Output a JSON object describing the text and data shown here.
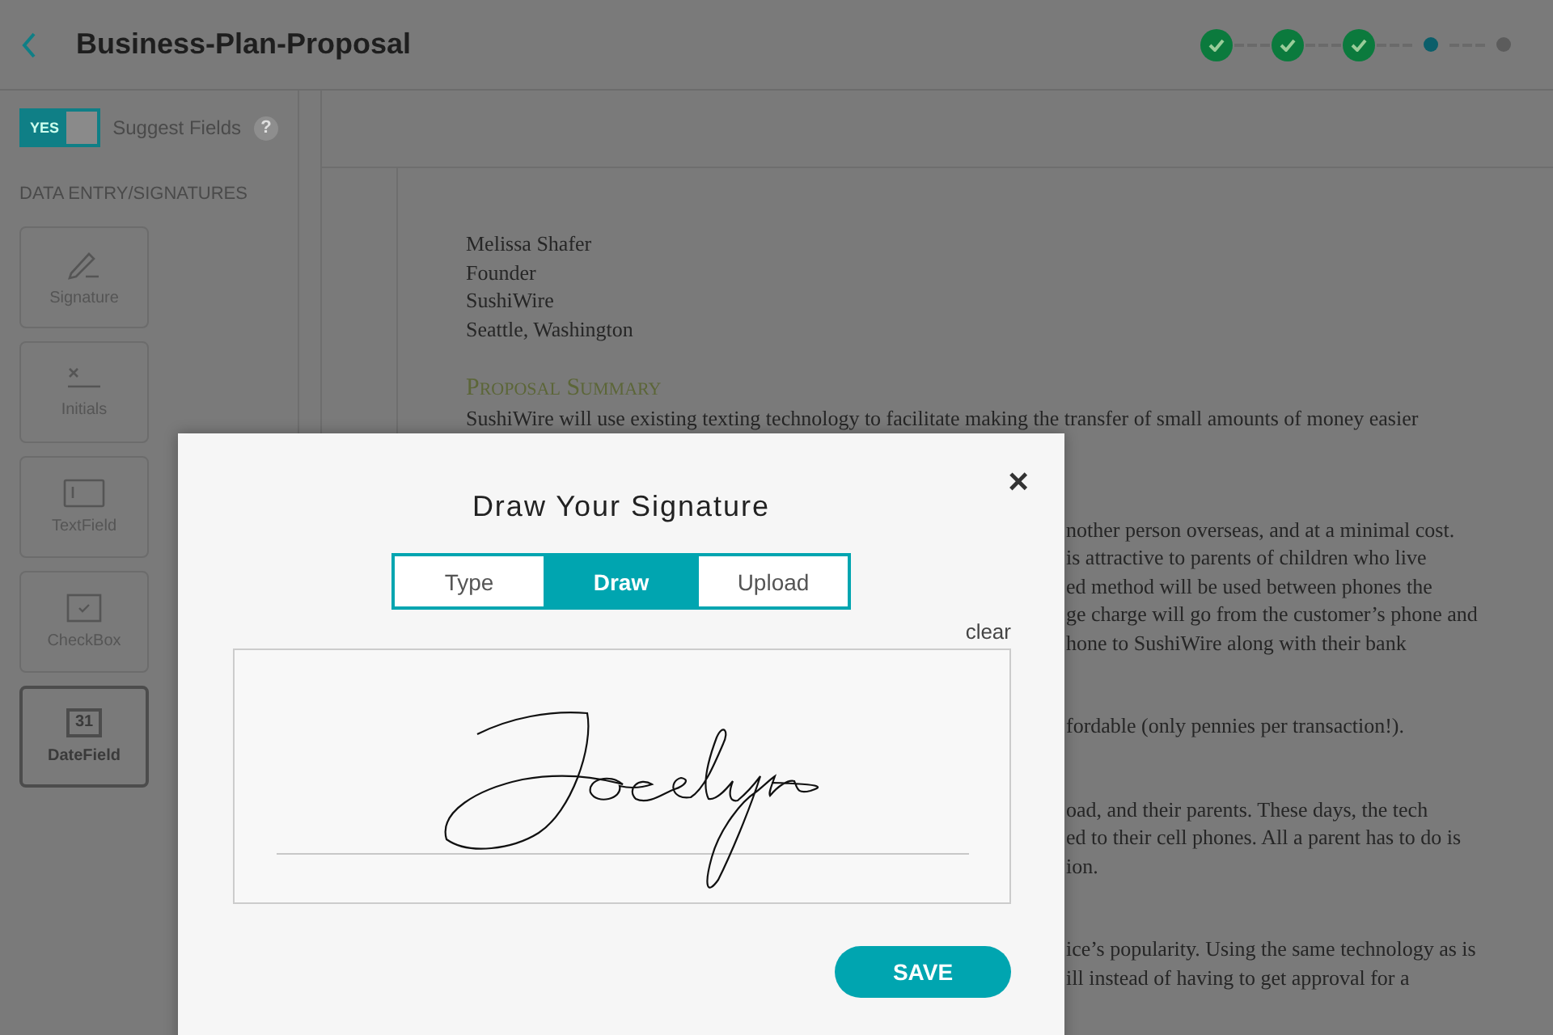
{
  "header": {
    "title": "Business-Plan-Proposal",
    "steps": [
      {
        "done": true,
        "current": false
      },
      {
        "done": true,
        "current": false
      },
      {
        "done": true,
        "current": false
      },
      {
        "done": false,
        "current": true
      },
      {
        "done": false,
        "current": false
      }
    ]
  },
  "sidebar": {
    "suggest_toggle": {
      "on": true,
      "label": "YES"
    },
    "suggest_label": "Suggest Fields",
    "help": "?",
    "section": "DATA ENTRY/SIGNATURES",
    "tools": [
      {
        "kind": "signature",
        "label": "Signature",
        "selected": false
      },
      {
        "kind": "initials",
        "label": "Initials",
        "selected": false
      },
      {
        "kind": "textfield",
        "label": "TextField",
        "selected": false
      },
      {
        "kind": "checkbox",
        "label": "CheckBox",
        "selected": false
      },
      {
        "kind": "date",
        "label": "DateField",
        "icon_text": "31",
        "selected": true
      }
    ]
  },
  "document": {
    "address": [
      "Melissa Shafer",
      "Founder",
      "SushiWire",
      "Seattle, Washington"
    ],
    "heading": "Proposal Summary",
    "summary_line": "SushiWire will use existing texting technology to facilitate making the transfer of small amounts of money easier",
    "fragments": [
      [
        "nother person overseas, and at a minimal cost.",
        "is attractive to parents of children who live",
        "ed method will be used between phones the",
        "ge charge will go from the customer’s phone and",
        "hone to SushiWire along with their bank"
      ],
      [
        "fordable (only pennies per transaction!)."
      ],
      [
        "oad, and their parents. These days, the tech",
        "ed to their cell phones. All a parent has to do is",
        "ion."
      ],
      [
        "ice’s popularity. Using the same technology as is",
        "ill instead of having to get approval for a"
      ]
    ]
  },
  "dialog": {
    "title": "Draw Your Signature",
    "close": "×",
    "tabs": [
      {
        "label": "Type",
        "selected": false
      },
      {
        "label": "Draw",
        "selected": true
      },
      {
        "label": "Upload",
        "selected": false
      }
    ],
    "clear": "clear",
    "save": "SAVE"
  }
}
